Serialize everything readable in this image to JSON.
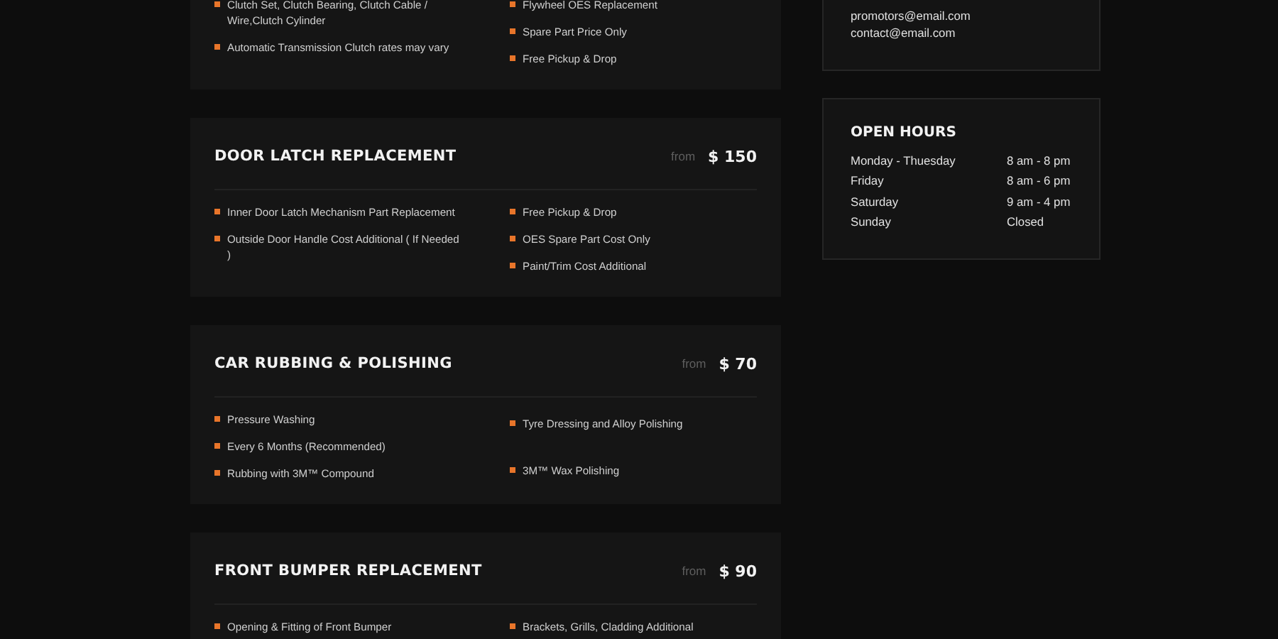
{
  "services": [
    {
      "left": [
        "Clutch Set, Clutch Bearing, Clutch Cable / Wire,Clutch Cylinder",
        "Automatic Transmission Clutch rates may vary"
      ],
      "right": [
        "Flywheel OES Replacement",
        "Spare Part Price Only",
        "Free Pickup & Drop"
      ]
    },
    {
      "title": "DOOR LATCH REPLACEMENT",
      "from": "from",
      "price": "$ 150",
      "left": [
        "Inner Door Latch Mechanism Part Replacement",
        "Outside Door Handle Cost Additional ( If Needed )"
      ],
      "right": [
        "Free Pickup & Drop",
        "OES Spare Part Cost Only",
        "Paint/Trim Cost Additional"
      ]
    },
    {
      "title": "CAR RUBBING & POLISHING",
      "from": "from",
      "price": "$ 70",
      "left": [
        "Pressure Washing",
        "Every 6 Months (Recommended)",
        "Rubbing with 3M™ Compound"
      ],
      "right": [
        "Tyre Dressing and Alloy Polishing",
        "3M™ Wax Polishing"
      ]
    },
    {
      "title": "FRONT BUMPER REPLACEMENT",
      "from": "from",
      "price": "$ 90",
      "left": [
        "Opening & Fitting of Front Bumper"
      ],
      "right": [
        "Brackets, Grills, Cladding Additional"
      ]
    }
  ],
  "contact": {
    "emails": [
      "promotors@email.com",
      "contact@email.com"
    ]
  },
  "open_hours": {
    "title": "OPEN HOURS",
    "rows": [
      {
        "day": "Monday - Thuesday",
        "hours": "8 am - 8 pm"
      },
      {
        "day": "Friday",
        "hours": "8 am - 6 pm"
      },
      {
        "day": "Saturday",
        "hours": "9 am - 4 pm"
      },
      {
        "day": "Sunday",
        "hours": "Closed"
      }
    ]
  }
}
